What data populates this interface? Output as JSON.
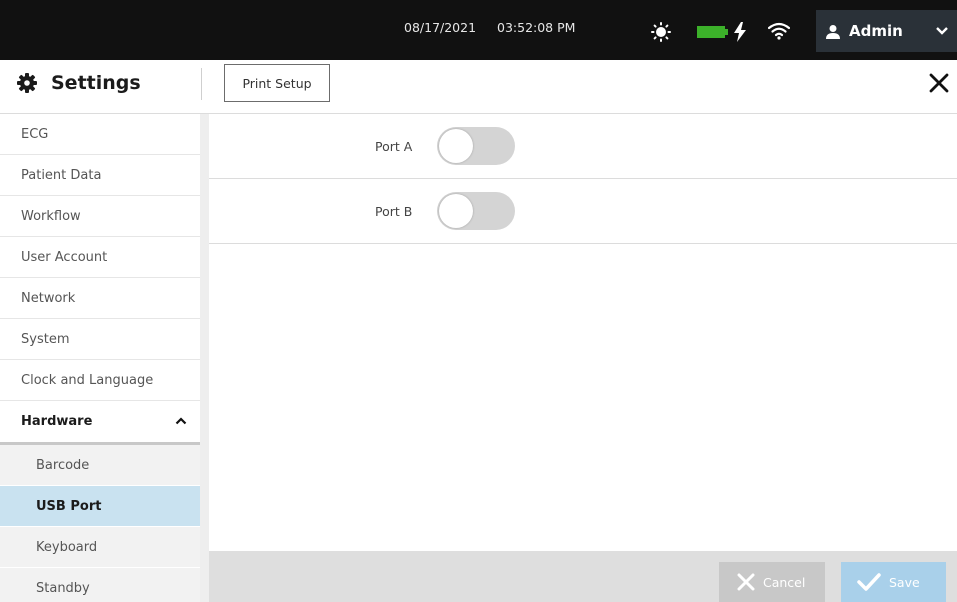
{
  "status_bar": {
    "date": "08/17/2021",
    "time": "03:52:08 PM",
    "icons": [
      "brightness-icon",
      "battery-icon",
      "charging-bolt-icon",
      "wifi-icon"
    ],
    "user": "Admin"
  },
  "header": {
    "title": "Settings",
    "print_setup_label": "Print Setup"
  },
  "sidebar": {
    "items": [
      {
        "label": "ECG"
      },
      {
        "label": "Patient Data"
      },
      {
        "label": "Workflow"
      },
      {
        "label": "User Account"
      },
      {
        "label": "Network"
      },
      {
        "label": "System"
      },
      {
        "label": "Clock and Language"
      }
    ],
    "group": {
      "label": "Hardware",
      "expanded": true,
      "children": [
        {
          "label": "Barcode"
        },
        {
          "label": "USB Port",
          "selected": true
        },
        {
          "label": "Keyboard"
        },
        {
          "label": "Standby"
        }
      ]
    }
  },
  "content": {
    "ports": [
      {
        "label": "Port A",
        "enabled": false
      },
      {
        "label": "Port B",
        "enabled": false
      }
    ]
  },
  "footer": {
    "cancel_label": "Cancel",
    "save_label": "Save"
  },
  "colors": {
    "status_bar": "#111111",
    "battery": "#3cb12a",
    "selected_item": "#c9e2f0",
    "save_button": "#a9d0ea",
    "cancel_button": "#c8c8c8"
  }
}
